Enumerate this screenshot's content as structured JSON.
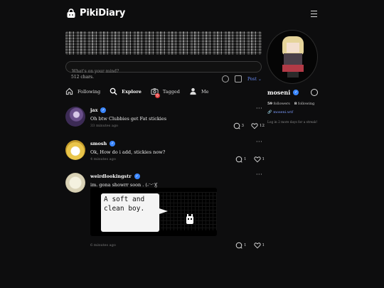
{
  "app": {
    "name": "PikiDiary"
  },
  "composer": {
    "placeholder": "What's on your mind?",
    "char_count": "512 chars.",
    "post_label": "Post"
  },
  "tabs": [
    {
      "label": "Following",
      "icon": "home-icon"
    },
    {
      "label": "Explore",
      "icon": "search-icon"
    },
    {
      "label": "Tagged",
      "icon": "camera-tag-icon",
      "badge": "0"
    },
    {
      "label": "Me",
      "icon": "user-icon"
    }
  ],
  "posts": [
    {
      "user": "jax",
      "text": "Oh btw Clubbies get Fat stickies",
      "time": "33 minutes ago",
      "comments": "3",
      "likes": "12"
    },
    {
      "user": "smosh",
      "text": "Ok, How do i add, stickies now?",
      "time": "4 minutes ago",
      "comments": "1",
      "likes": "1"
    },
    {
      "user": "weirdlookingstr",
      "text": "im. gona showrr soon . (˶ᵔᵕᵔ)ʃ",
      "time": "6 minutes ago",
      "comments": "1",
      "likes": "1",
      "media_text": "A soft and clean boy."
    }
  ],
  "profile": {
    "username": "moseni",
    "followers": "59",
    "followers_label": "followers",
    "following": "8",
    "following_label": "following",
    "website": "moseni.wtf",
    "streak_note": "Log in 2 more days for a streak!"
  },
  "colors": {
    "background": "#0d0d0e",
    "accent": "#3a86ff",
    "link": "#7d9cff",
    "badge": "#e23b3b"
  }
}
